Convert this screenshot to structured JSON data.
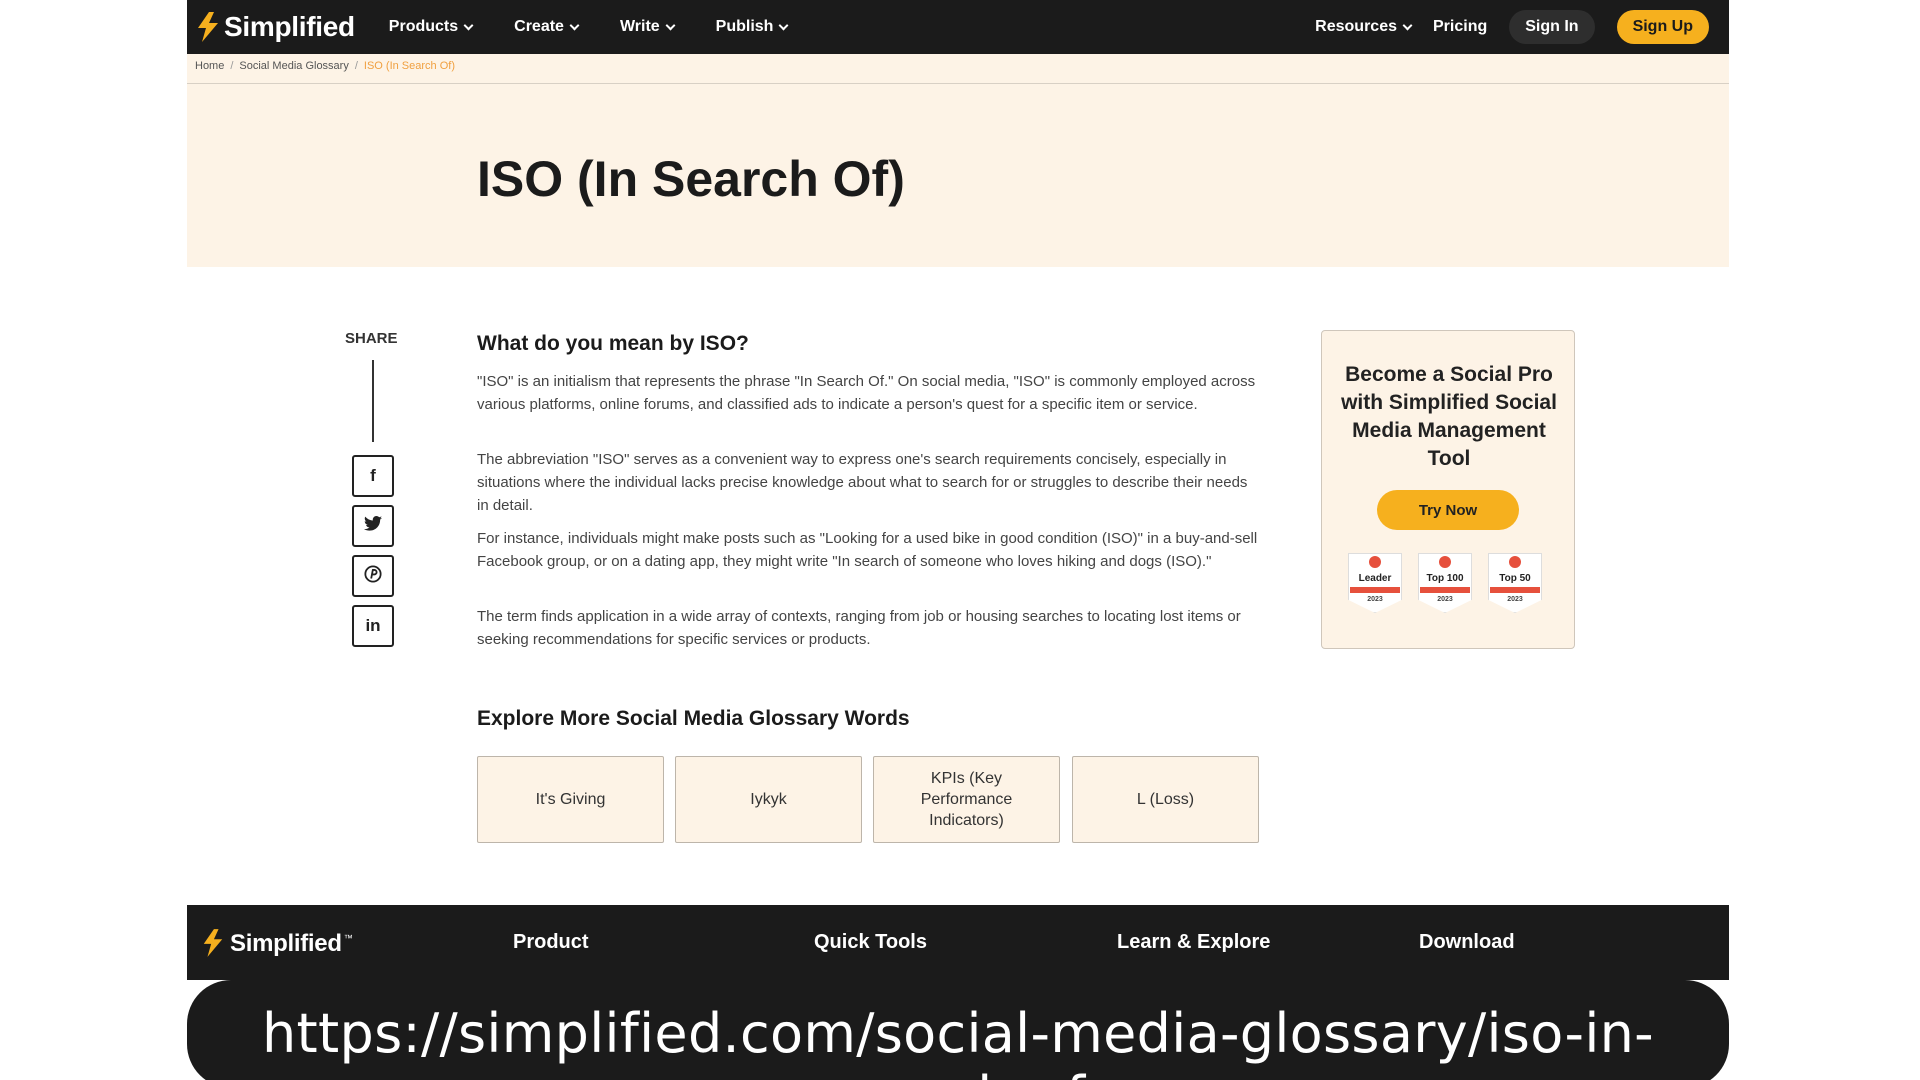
{
  "nav": {
    "brand": "Simplified",
    "items": [
      {
        "label": "Products"
      },
      {
        "label": "Create"
      },
      {
        "label": "Write"
      },
      {
        "label": "Publish"
      }
    ],
    "resources": "Resources",
    "pricing": "Pricing",
    "sign_in": "Sign In",
    "sign_up": "Sign Up"
  },
  "breadcrumb": {
    "home": "Home",
    "section": "Social Media Glossary",
    "current": "ISO (In Search Of)",
    "separator": "/"
  },
  "page_title": "ISO (In Search Of)",
  "share": {
    "label": "SHARE",
    "icons": [
      "facebook-icon",
      "twitter-icon",
      "pinterest-icon",
      "linkedin-icon"
    ],
    "glyphs": [
      "f",
      "🐦",
      "℗",
      "in"
    ]
  },
  "article": {
    "heading": "What do you mean by ISO?",
    "paragraphs": [
      "\"ISO\" is an initialism that represents the phrase \"In Search Of.\" On social media, \"ISO\" is commonly employed across various platforms, online forums, and classified ads to indicate a person's quest for a specific item or service.",
      "The abbreviation \"ISO\" serves as a convenient way to express one's search requirements concisely, especially in situations where the individual lacks precise knowledge about what to search for or struggles to describe their needs in detail.",
      "For instance, individuals might make posts such as \"Looking for a used bike in good condition (ISO)\" in a buy-and-sell Facebook group, or on a dating app, they might write \"In search of someone who loves hiking and dogs (ISO).\"",
      "The term finds application in a wide array of contexts, ranging from job or housing searches to locating lost items or seeking recommendations for specific services or products."
    ]
  },
  "promo": {
    "title": "Become a Social Pro with Simplified Social Media Management Tool",
    "button": "Try Now",
    "badges": [
      {
        "label": "Leader",
        "year": "2023"
      },
      {
        "label": "Top 100",
        "year": "2023"
      },
      {
        "label": "Top 50",
        "year": "2023"
      }
    ]
  },
  "explore": {
    "heading": "Explore More Social Media Glossary Words",
    "cards": [
      "It's Giving",
      "Iykyk",
      "KPIs (Key Performance Indicators)",
      "L (Loss)"
    ]
  },
  "footer": {
    "brand": "Simplified",
    "tm": "™",
    "links": [
      "Product",
      "Quick Tools",
      "Learn & Explore",
      "Download"
    ]
  },
  "url": "https://simplified.com/social-media-glossary/iso-in-search-of",
  "colors": {
    "accent": "#f6b01e",
    "dark": "#1b1b1b",
    "cream": "#fdf3e6"
  }
}
